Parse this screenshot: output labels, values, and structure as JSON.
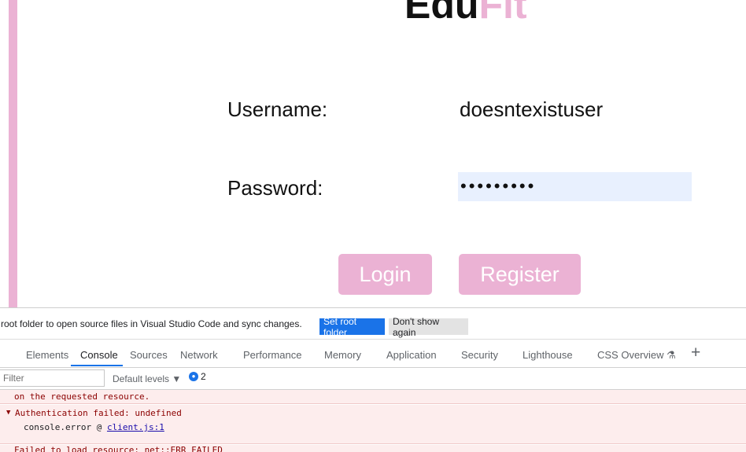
{
  "app": {
    "logo_dark": "Edu",
    "logo_accent": "Fit",
    "username_label": "Username:",
    "username_value": "doesntexistuser",
    "password_label": "Password:",
    "password_value": "•••••••••",
    "login_label": "Login",
    "register_label": "Register",
    "accent_color": "#ebb2d4"
  },
  "devtools": {
    "infobar": {
      "message": "root folder to open source files in Visual Studio Code and sync changes.",
      "set_root_label": "Set root folder",
      "dont_show_label": "Don't show again"
    },
    "tabs": [
      {
        "label": "Elements"
      },
      {
        "label": "Console"
      },
      {
        "label": "Sources"
      },
      {
        "label": "Network"
      },
      {
        "label": "Performance"
      },
      {
        "label": "Memory"
      },
      {
        "label": "Application"
      },
      {
        "label": "Security"
      },
      {
        "label": "Lighthouse"
      },
      {
        "label": "CSS Overview ⚗"
      }
    ],
    "active_tab": "Console",
    "filter_placeholder": "Filter",
    "levels_label": "Default levels ▼",
    "message_count": "2",
    "console": {
      "line1": "on the requested resource.",
      "line2_prefix": "▼",
      "line2_text": "Authentication failed: undefined",
      "line3_text": "console.error @ ",
      "line3_link": "client.js:1",
      "line4": "Failed to load resource: net::ERR_FAILED"
    }
  }
}
